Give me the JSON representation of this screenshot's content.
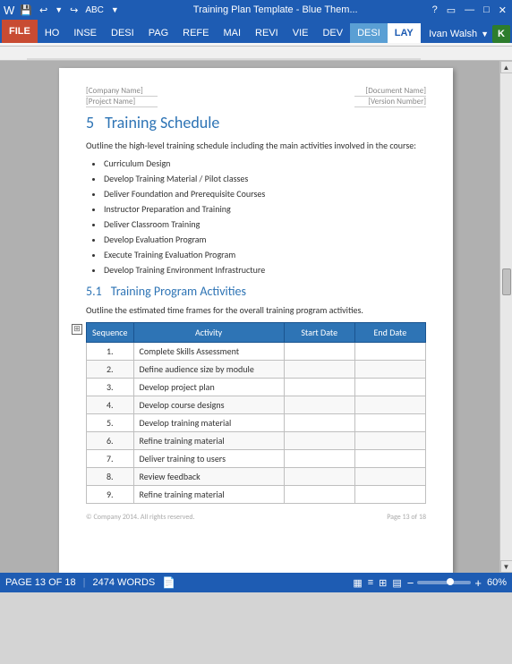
{
  "titlebar": {
    "title": "Training Plan Template - Blue Them...",
    "help_icon": "?",
    "minimize_icon": "—",
    "maximize_icon": "□",
    "close_icon": "✕"
  },
  "quickaccess": {
    "save_label": "💾",
    "undo_label": "↩",
    "redo_label": "↪",
    "print_label": "🖨",
    "custom_label": "▼"
  },
  "ribbon": {
    "tabs": [
      {
        "id": "file",
        "label": "FILE",
        "type": "file"
      },
      {
        "id": "home",
        "label": "HO",
        "type": "normal"
      },
      {
        "id": "insert",
        "label": "INSE",
        "type": "normal"
      },
      {
        "id": "design",
        "label": "DESI",
        "type": "normal"
      },
      {
        "id": "page",
        "label": "PAG",
        "type": "normal"
      },
      {
        "id": "references",
        "label": "REFE",
        "type": "normal"
      },
      {
        "id": "mailings",
        "label": "MAI",
        "type": "normal"
      },
      {
        "id": "review",
        "label": "REVI",
        "type": "normal"
      },
      {
        "id": "view",
        "label": "VIE",
        "type": "normal"
      },
      {
        "id": "dev",
        "label": "DEV",
        "type": "normal"
      },
      {
        "id": "design2",
        "label": "DESI",
        "type": "highlighted"
      },
      {
        "id": "layout",
        "label": "LAY",
        "type": "active"
      }
    ],
    "user": "Ivan Walsh",
    "user_initial": "K"
  },
  "page": {
    "header": {
      "company_label": "[Company Name]",
      "project_label": "[Project Name]",
      "doc_label": "[Document Name]",
      "version_label": "[Version Number]"
    },
    "section5": {
      "number": "5",
      "title": "Training Schedule",
      "intro": "Outline the high-level training schedule including the main activities involved in the course:",
      "bullets": [
        "Curriculum Design",
        "Develop Training Material / Pilot classes",
        "Deliver Foundation and Prerequisite Courses",
        "Instructor Preparation and Training",
        "Deliver Classroom Training",
        "Develop Evaluation Program",
        "Execute Training Evaluation Program",
        "Develop Training Environment Infrastructure"
      ]
    },
    "section51": {
      "number": "5.1",
      "title": "Training Program Activities",
      "intro": "Outline the estimated time frames for the overall training program activities.",
      "table": {
        "columns": [
          "Sequence",
          "Activity",
          "Start Date",
          "End Date"
        ],
        "rows": [
          {
            "seq": "1.",
            "activity": "Complete Skills Assessment",
            "start": "",
            "end": ""
          },
          {
            "seq": "2.",
            "activity": "Define audience size by module",
            "start": "",
            "end": ""
          },
          {
            "seq": "3.",
            "activity": "Develop project plan",
            "start": "",
            "end": ""
          },
          {
            "seq": "4.",
            "activity": "Develop course designs",
            "start": "",
            "end": ""
          },
          {
            "seq": "5.",
            "activity": "Develop training material",
            "start": "",
            "end": ""
          },
          {
            "seq": "6.",
            "activity": "Refine training material",
            "start": "",
            "end": ""
          },
          {
            "seq": "7.",
            "activity": "Deliver training to users",
            "start": "",
            "end": ""
          },
          {
            "seq": "8.",
            "activity": "Review feedback",
            "start": "",
            "end": ""
          },
          {
            "seq": "9.",
            "activity": "Refine training material",
            "start": "",
            "end": ""
          }
        ]
      }
    },
    "footer": {
      "copyright": "© Company 2014. All rights reserved.",
      "page": "Page 13 of 18"
    }
  },
  "statusbar": {
    "page_info": "PAGE 13 OF 18",
    "word_count": "2474 WORDS",
    "zoom_minus": "−",
    "zoom_plus": "+",
    "zoom_level": "60%"
  }
}
